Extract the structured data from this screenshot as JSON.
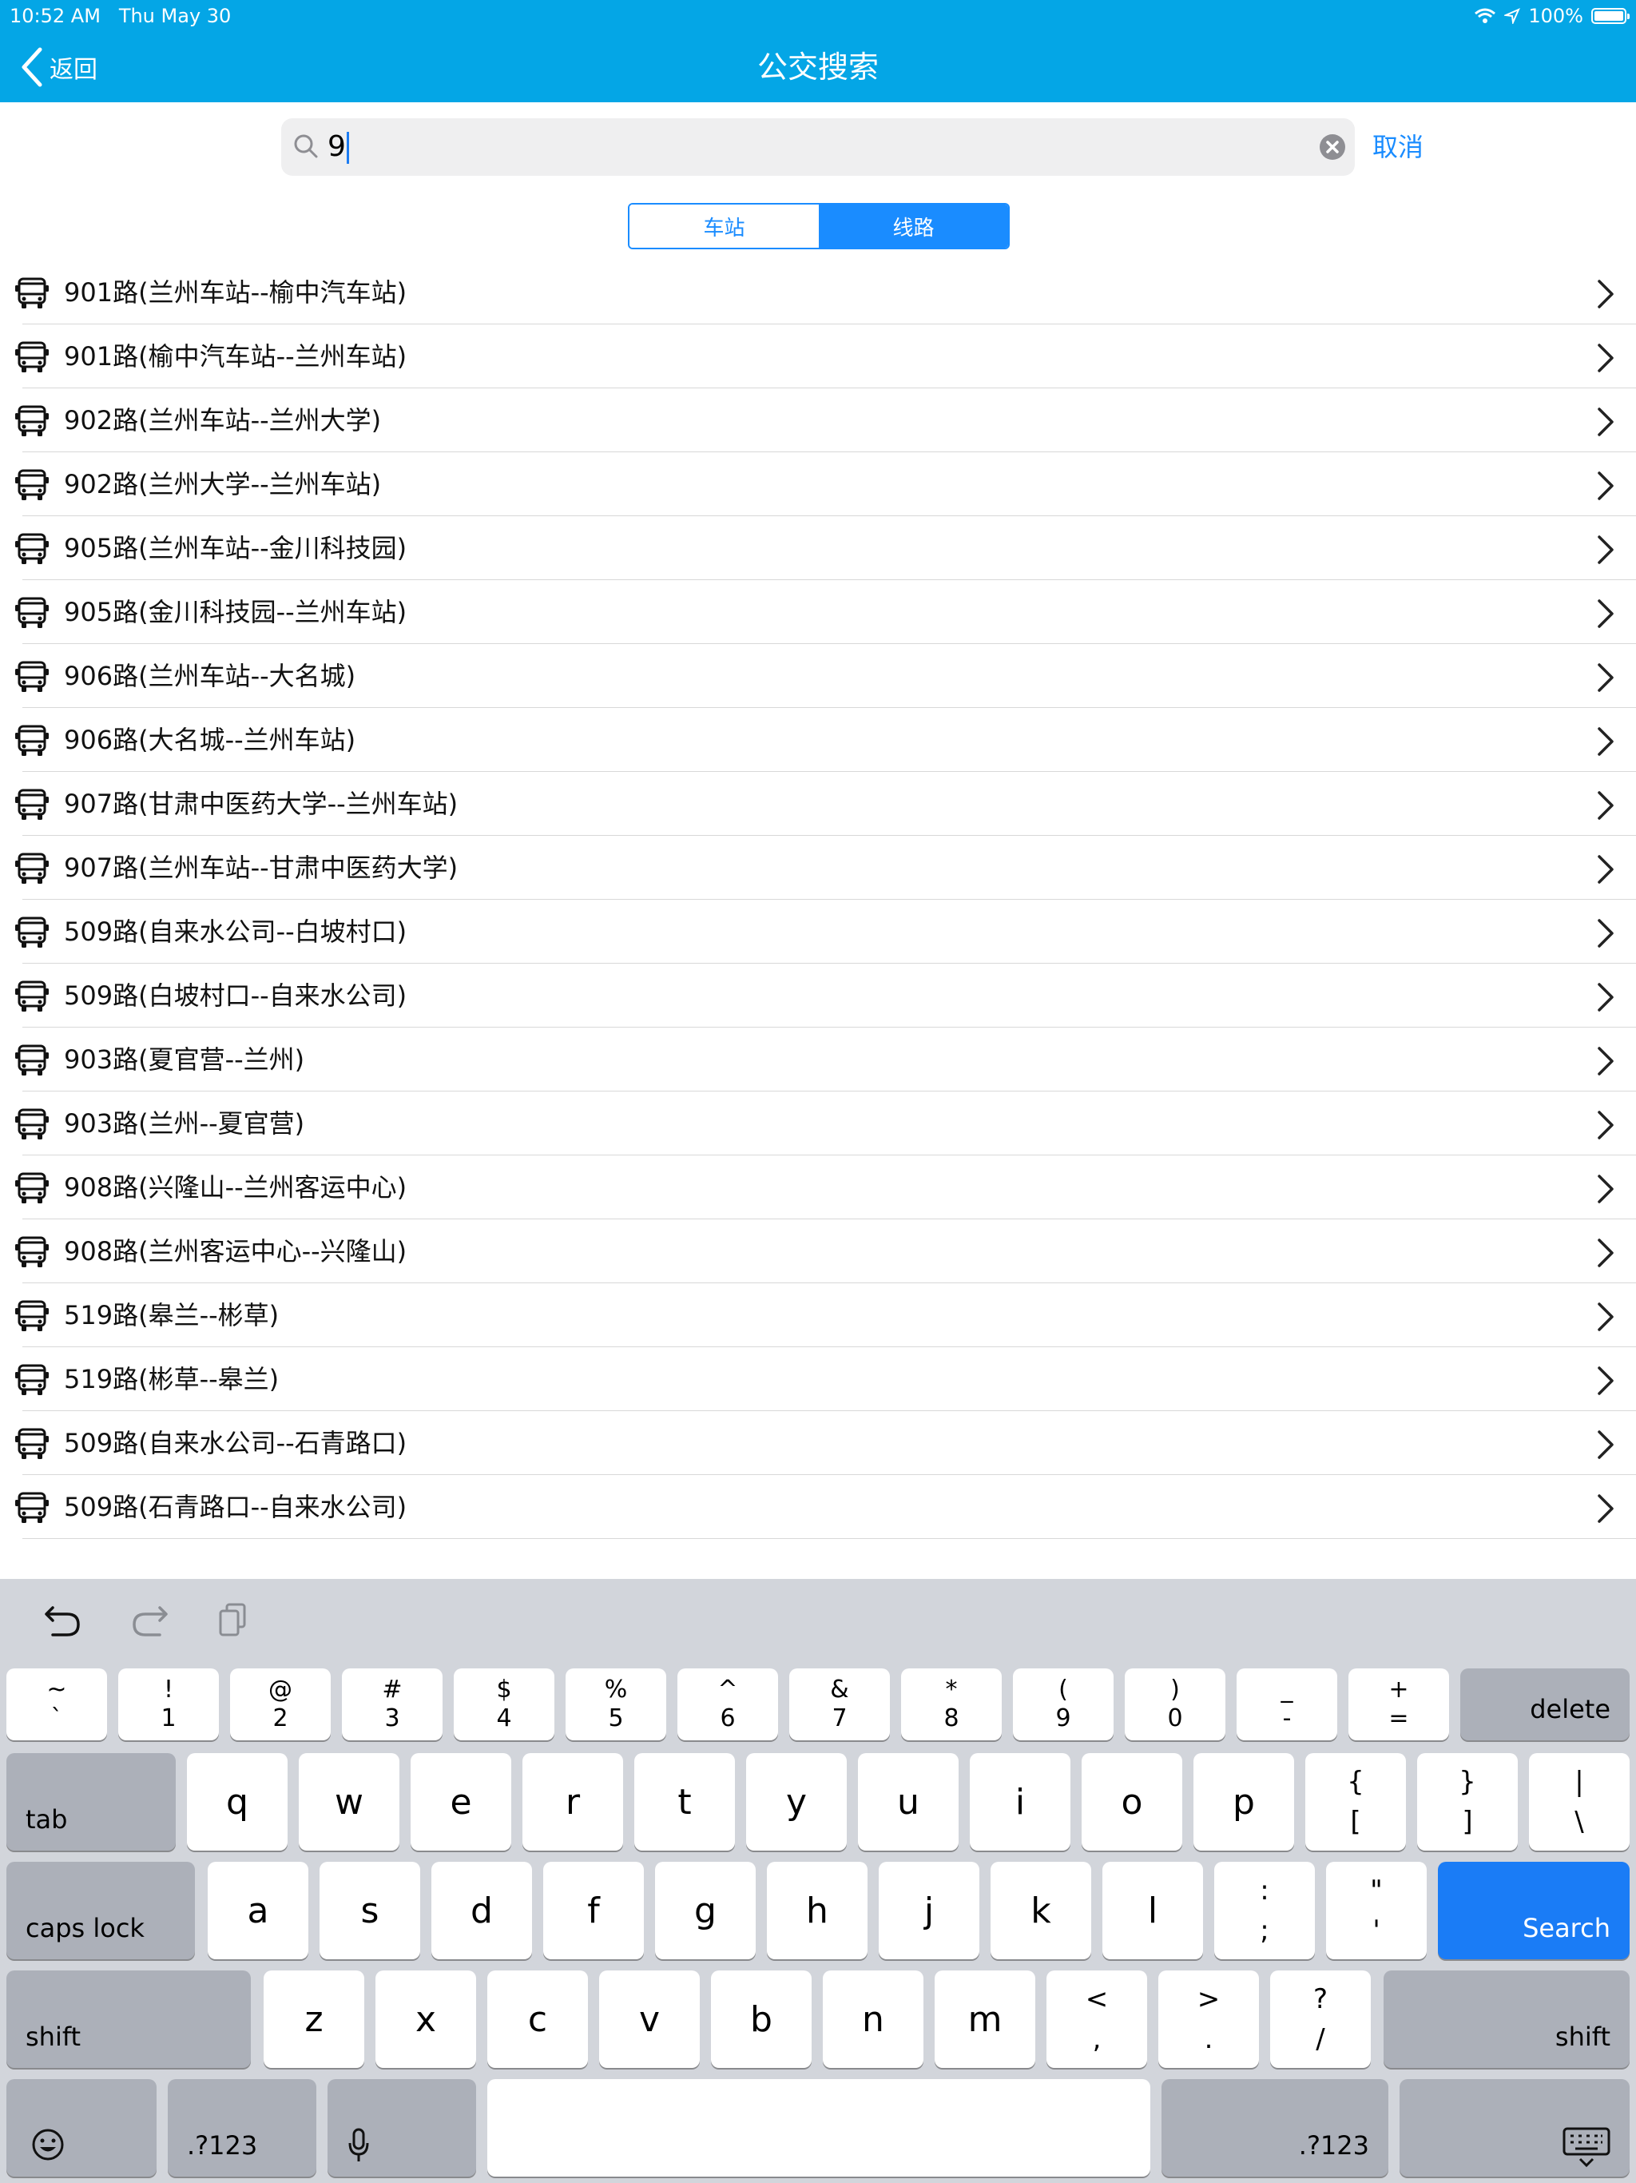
{
  "status_bar": {
    "time": "10:52 AM",
    "date": "Thu May 30",
    "battery_percent": "100%",
    "battery_level": 1.0
  },
  "nav": {
    "back_label": "返回",
    "title": "公交搜索"
  },
  "search": {
    "value": "9",
    "cancel_label": "取消"
  },
  "segments": [
    {
      "label": "车站",
      "selected": false
    },
    {
      "label": "线路",
      "selected": true
    }
  ],
  "routes": [
    "901路(兰州车站--榆中汽车站)",
    "901路(榆中汽车站--兰州车站)",
    "902路(兰州车站--兰州大学)",
    "902路(兰州大学--兰州车站)",
    "905路(兰州车站--金川科技园)",
    "905路(金川科技园--兰州车站)",
    "906路(兰州车站--大名城)",
    "906路(大名城--兰州车站)",
    "907路(甘肃中医药大学--兰州车站)",
    "907路(兰州车站--甘肃中医药大学)",
    "509路(自来水公司--白坡村口)",
    "509路(白坡村口--自来水公司)",
    "903路(夏官营--兰州)",
    "903路(兰州--夏官营)",
    "908路(兴隆山--兰州客运中心)",
    "908路(兰州客运中心--兴隆山)",
    "519路(皋兰--彬草)",
    "519路(彬草--皋兰)",
    "509路(自来水公司--石青路口)",
    "509路(石青路口--自来水公司)"
  ],
  "keyboard": {
    "toolbar": [
      "undo-icon",
      "redo-icon",
      "paste-icon"
    ],
    "row1": [
      {
        "top": "~",
        "bottom": "`"
      },
      {
        "top": "!",
        "bottom": "1"
      },
      {
        "top": "@",
        "bottom": "2"
      },
      {
        "top": "#",
        "bottom": "3"
      },
      {
        "top": "$",
        "bottom": "4"
      },
      {
        "top": "%",
        "bottom": "5"
      },
      {
        "top": "^",
        "bottom": "6"
      },
      {
        "top": "&",
        "bottom": "7"
      },
      {
        "top": "*",
        "bottom": "8"
      },
      {
        "top": "(",
        "bottom": "9"
      },
      {
        "top": ")",
        "bottom": "0"
      },
      {
        "top": "_",
        "bottom": "-"
      },
      {
        "top": "+",
        "bottom": "="
      }
    ],
    "delete_label": "delete",
    "tab_label": "tab",
    "row2": [
      "q",
      "w",
      "e",
      "r",
      "t",
      "y",
      "u",
      "i",
      "o",
      "p"
    ],
    "row2_symbols": [
      {
        "top": "{",
        "bottom": "["
      },
      {
        "top": "}",
        "bottom": "]"
      },
      {
        "top": "|",
        "bottom": "\\"
      }
    ],
    "caps_label": "caps lock",
    "row3": [
      "a",
      "s",
      "d",
      "f",
      "g",
      "h",
      "j",
      "k",
      "l"
    ],
    "row3_symbols": [
      {
        "top": ":",
        "bottom": ";"
      },
      {
        "top": "\"",
        "bottom": "'"
      }
    ],
    "search_label": "Search",
    "shift_label": "shift",
    "row4": [
      "z",
      "x",
      "c",
      "v",
      "b",
      "n",
      "m"
    ],
    "row4_symbols": [
      {
        "top": "<",
        "bottom": ","
      },
      {
        "top": ">",
        "bottom": "."
      },
      {
        "top": "?",
        "bottom": "/"
      }
    ],
    "numbers_label": ".?123"
  }
}
